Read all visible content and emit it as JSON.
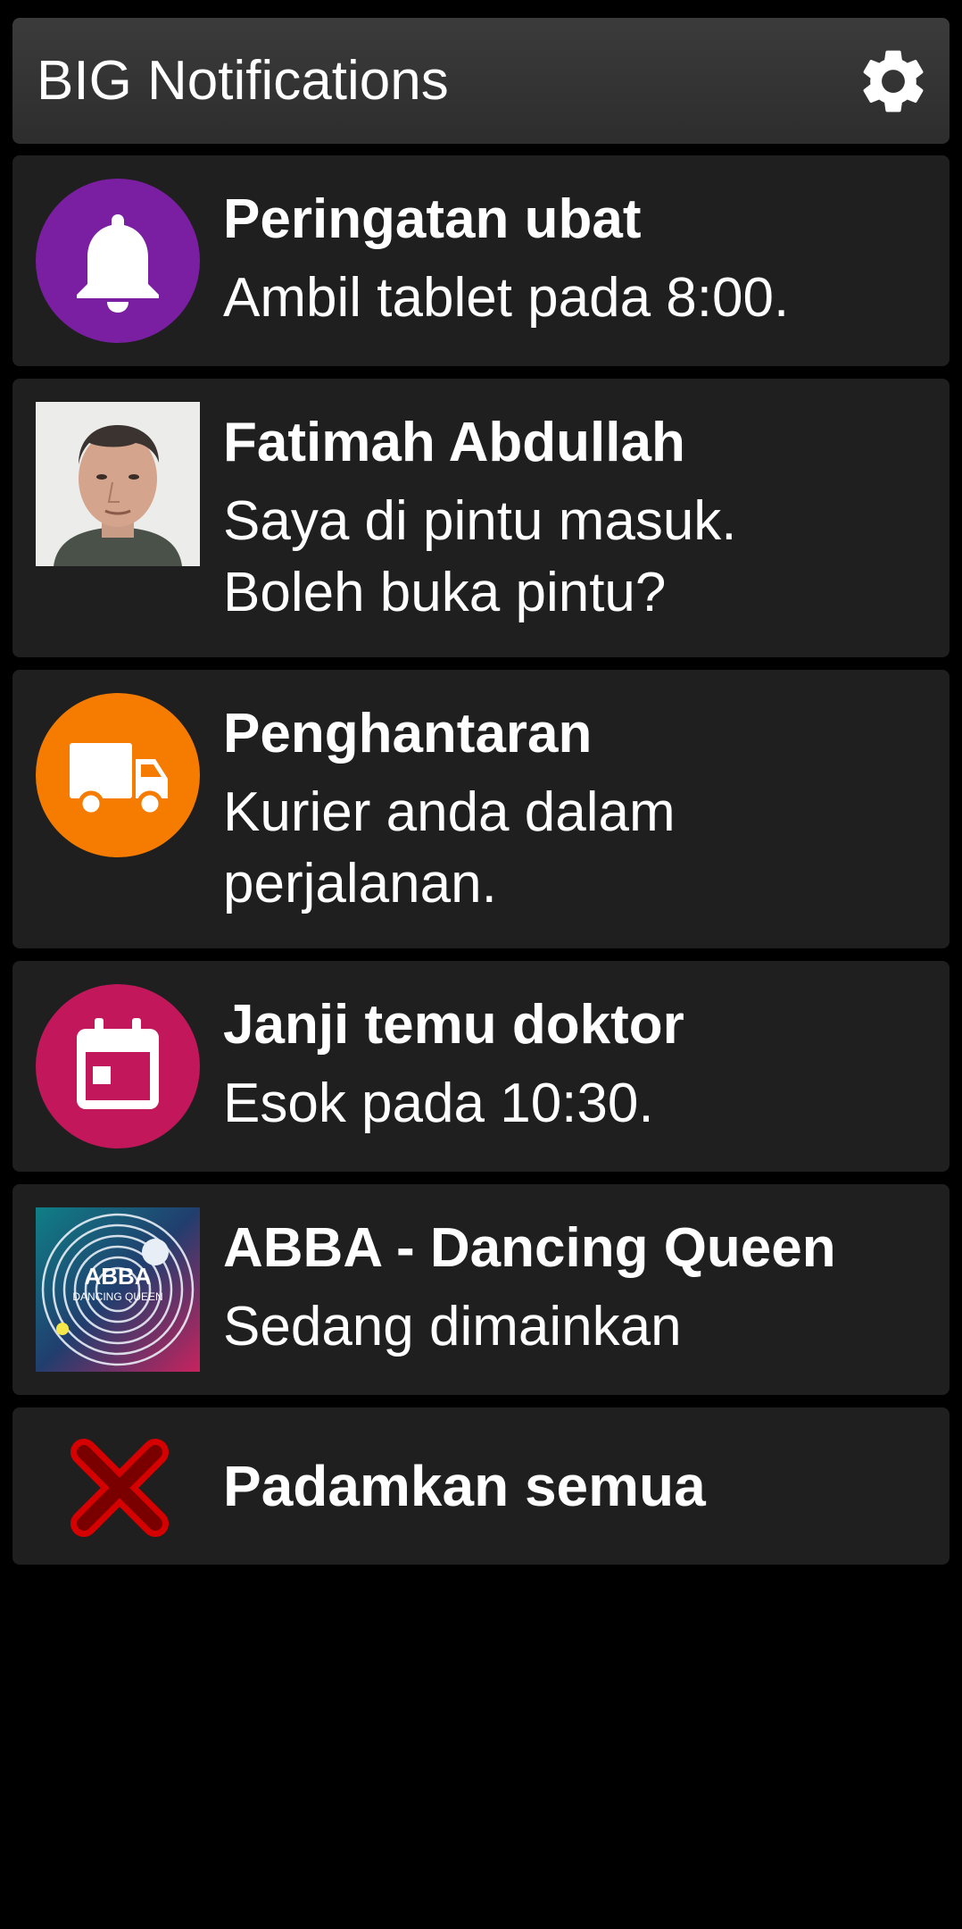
{
  "header": {
    "title": "BIG Notifications",
    "settings_icon": "gear-icon"
  },
  "notifications": [
    {
      "title": "Peringatan ubat",
      "body": "Ambil tablet pada 8:00.",
      "icon": "bell-icon",
      "icon_color": "#7b1fa2"
    },
    {
      "title": "Fatimah Abdullah",
      "body": "Saya di pintu masuk. Boleh buka pintu?",
      "icon": "contact-avatar"
    },
    {
      "title": "Penghantaran",
      "body": "Kurier anda dalam perjalanan.",
      "icon": "truck-icon",
      "icon_color": "#f57c00"
    },
    {
      "title": "Janji temu doktor",
      "body": "Esok pada 10:30.",
      "icon": "calendar-icon",
      "icon_color": "#c2185b"
    },
    {
      "title": "ABBA - Dancing Queen",
      "body": "Sedang dimainkan",
      "icon": "album-art",
      "album_text": "ABBA",
      "album_subtext": "DANCING QUEEN"
    }
  ],
  "dismiss_all": {
    "label": "Padamkan semua",
    "icon": "close-icon",
    "icon_color": "#d50000"
  }
}
